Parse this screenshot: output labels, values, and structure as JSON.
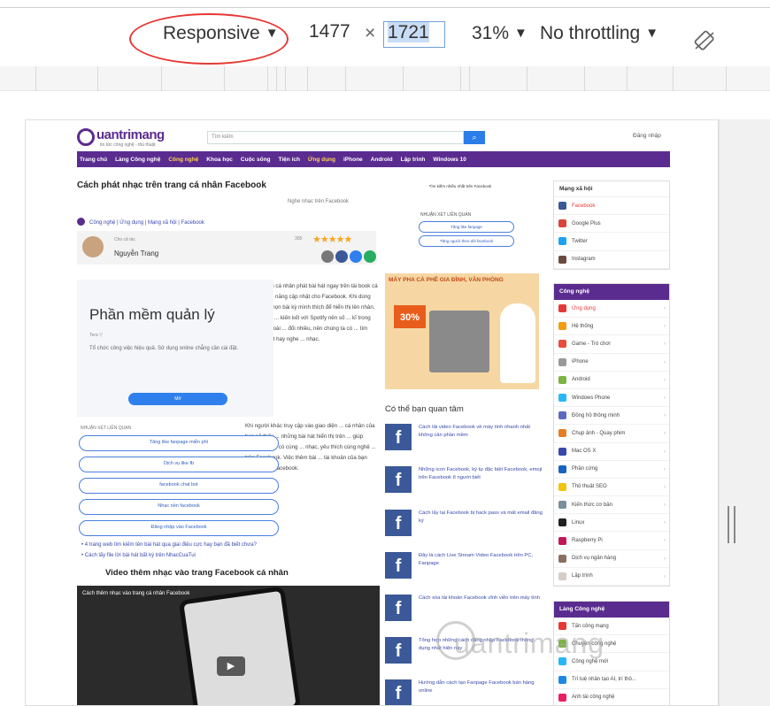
{
  "devtools": {
    "device": "Responsive",
    "width": "1477",
    "times": "×",
    "height": "1721",
    "zoom": "31%",
    "throttling": "No throttling"
  },
  "site": {
    "logo": "uantrimang",
    "logo_sub": "tin tức công nghệ - thủ thuật",
    "search_placeholder": "Tìm kiếm",
    "login": "Đăng nhập",
    "nav": [
      "Trang chủ",
      "Làng Công nghệ",
      "Công nghệ",
      "Khoa học",
      "Cuộc sống",
      "Tiện ích",
      "Ứng dụng",
      "iPhone",
      "Android",
      "Lập trình",
      "Windows 10"
    ]
  },
  "article": {
    "title": "Cách phát nhạc trên trang cá nhân Facebook",
    "subtitle": "Nghe nhạc trên Facebook",
    "breadcrumbs": "Công nghệ  |  Ứng dụng  |  Mạng xã hội  |  Facebook",
    "author_label": "Cho cả tác",
    "author": "Nguyễn Trang",
    "likes": "305",
    "stars": "★★★★★",
    "body_1": "... vào trang cá nhân phát bài hát ngay trên tài book cá nhân là tính năng cập nhật cho Facebook. Khi dùng được lựa chọn bài kỳ mình thích để hiển thị lên nhân. Kho bài hát ... kiến kết với Spotify nên số ... kĩ trong nước và ngoài ... đối nhiều, nên chúng ta có ... tìm kiếm bài hát hay nghe ... nhạc.",
    "body_2": "Khi người khác truy cập vào giao diện ... cá nhân của bạn sẽ thấy ... những bài hát hiển thị trên ... giúp những người có cùng ... nhạc, yêu thích cùng nghệ ... trên Facebook. Việc thêm bài ... tài khoản của bạn hơn. Bài ... Facebook.",
    "links": [
      "4 trang web tìm kiếm tên bài hát qua giai điệu cực hay bạn đã biết chưa?",
      "Cách lấy file lời bài hát bất kỳ trên NhacCuaTui"
    ],
    "video_title": "Video thêm nhạc vào trang Facebook cá nhân",
    "video_caption": "Cách thêm nhạc vào trang cá nhân Facebook",
    "play": "▶"
  },
  "ad": {
    "title": "Phần mềm quản lý",
    "small": "Tera ▽",
    "desc": "Tổ chức công việc hiệu quả. Sử dụng online chẳng cần cài đặt.",
    "button": "Mở"
  },
  "related_pills": {
    "label": "NHUẬN XÉT LIÊN QUAN",
    "items": [
      "Tăng like fanpage miễn phí",
      "Dịch vụ like fb",
      "facebook chat bot",
      "Nhạc nền facebook",
      "Đăng nhập vào Facebook"
    ]
  },
  "middle": {
    "head": "Tìm kiếm nhiều nhất trên Facebook",
    "label": "NHUẬN XÉT LIÊN QUAN",
    "pills": [
      "Tăng like fanpage",
      "Tăng người theo dõi facebook"
    ],
    "coffee_title": "MÁY PHA CÀ PHÊ GIA ĐÌNH, VĂN PHÒNG",
    "coffee_badge": "30%",
    "suggest_title": "Có thể bạn quan tâm",
    "suggestions": [
      "Cách tải video Facebook về máy tính nhanh nhất không cần phần mềm",
      "Những icon Facebook, ký tự đặc biệt Facebook, emoji trên Facebook ít người biết",
      "Cách lấy lại Facebook bị hack pass và mất email đăng ký",
      "Đây là cách Live Stream Video Facebook trên PC, Fanpage",
      "Cách xóa tài khoản Facebook vĩnh viễn trên máy tính",
      "Tổng hợp những cách đăng nhập Facebook thông dụng nhất hiện nay",
      "Hướng dẫn cách tạo Fanpage Facebook bán hàng online"
    ]
  },
  "sidebar": {
    "social_head": "Mạng xã hội",
    "social": [
      "Facebook",
      "Google Plus",
      "Twitter",
      "Instagram"
    ],
    "tech_head": "Công nghệ",
    "tech": [
      "Ứng dụng",
      "Hệ thống",
      "Game - Trò chơi",
      "iPhone",
      "Android",
      "Windows Phone",
      "Đồng hồ thông minh",
      "Chụp ảnh - Quay phim",
      "Mac OS X",
      "Phần cứng",
      "Thủ thuật SEO",
      "Kiến thức cơ bản",
      "Linux",
      "Raspberry Pi",
      "Dịch vụ ngân hàng",
      "Lập trình"
    ],
    "lang_head": "Làng Công nghệ",
    "lang": [
      "Tấn công mạng",
      "Chuyện công nghệ",
      "Công nghệ mới",
      "Trí tuệ nhân tạo AI, trí thô...",
      "Anh tài công nghệ"
    ]
  },
  "watermark": "uantrimang",
  "colors": {
    "brand": "#5b2c8f",
    "ellipse": "#e53935",
    "link": "#3949ab"
  }
}
